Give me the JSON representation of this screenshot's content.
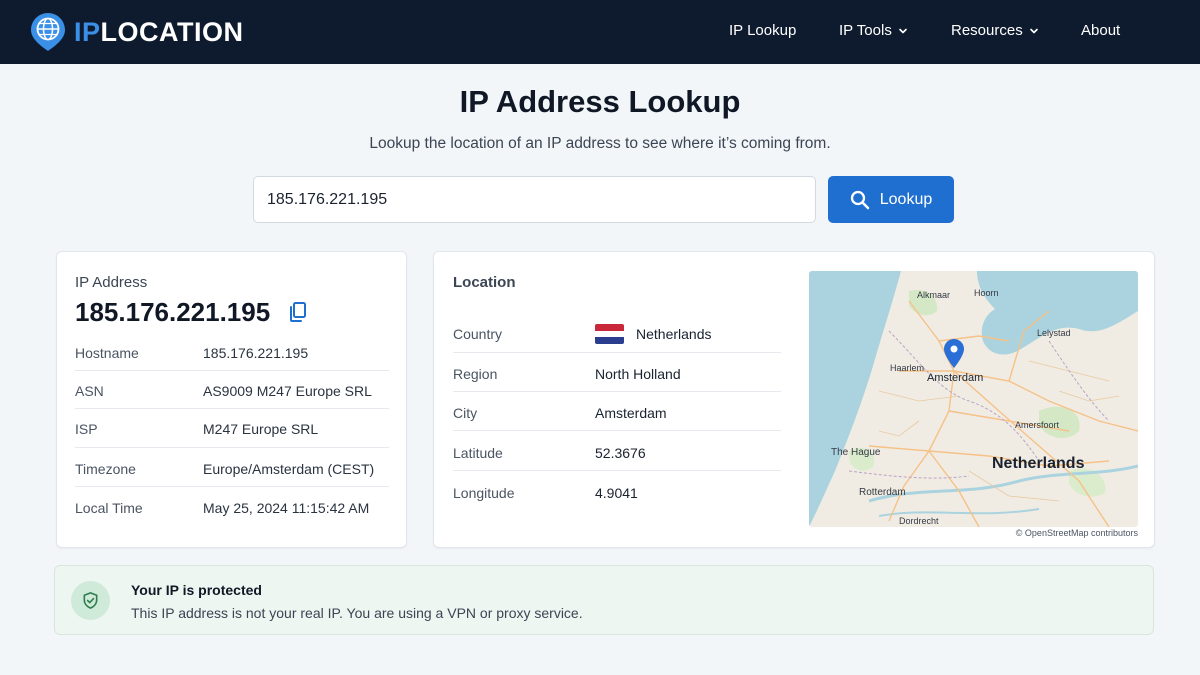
{
  "brand": {
    "prefix": "IP",
    "suffix": "LOCATION"
  },
  "nav": {
    "items": [
      {
        "label": "IP Lookup",
        "has_dropdown": false
      },
      {
        "label": "IP Tools",
        "has_dropdown": true
      },
      {
        "label": "Resources",
        "has_dropdown": true
      },
      {
        "label": "About",
        "has_dropdown": false
      }
    ]
  },
  "hero": {
    "title": "IP Address Lookup",
    "subtitle": "Lookup the location of an IP address to see where it’s coming from."
  },
  "search": {
    "value": "185.176.221.195",
    "button_label": "Lookup",
    "icon": "search-icon"
  },
  "ip_card": {
    "label": "IP Address",
    "ip": "185.176.221.195",
    "copy_icon": "copy-icon",
    "rows": [
      {
        "key": "Hostname",
        "value": "185.176.221.195"
      },
      {
        "key": "ASN",
        "value": "AS9009 M247 Europe SRL"
      },
      {
        "key": "ISP",
        "value": "M247 Europe SRL"
      },
      {
        "key": "Timezone",
        "value": "Europe/Amsterdam (CEST)"
      },
      {
        "key": "Local Time",
        "value": "May 25, 2024 11:15:42 AM"
      }
    ]
  },
  "location": {
    "heading": "Location",
    "rows": [
      {
        "key": "Country",
        "value": "Netherlands",
        "flag": "netherlands-flag"
      },
      {
        "key": "Region",
        "value": "North Holland"
      },
      {
        "key": "City",
        "value": "Amsterdam"
      },
      {
        "key": "Latitude",
        "value": "52.3676"
      },
      {
        "key": "Longitude",
        "value": "4.9041"
      }
    ],
    "map": {
      "labels": {
        "alkmaar": "Alkmaar",
        "hoorn": "Hoorn",
        "lelystad": "Lelystad",
        "haarlem": "Haarlem",
        "amsterdam": "Amsterdam",
        "amersfoort": "Amersfoort",
        "the_hague": "The Hague",
        "netherlands": "Netherlands",
        "rotterdam": "Rotterdam",
        "dordrecht": "Dordrecht"
      },
      "attribution": "© OpenStreetMap contributors"
    }
  },
  "banner": {
    "title": "Your IP is protected",
    "text": "This IP address is not your real IP. You are using a VPN or proxy service.",
    "icon": "shield-check-icon"
  },
  "colors": {
    "nav_bg": "#0e1b2e",
    "brand_accent": "#3a8fe6",
    "button_bg": "#1f6fd1",
    "banner_bg": "#eef6f1",
    "shield_green": "#2e7d4f",
    "map_pin": "#2a6fd6"
  }
}
